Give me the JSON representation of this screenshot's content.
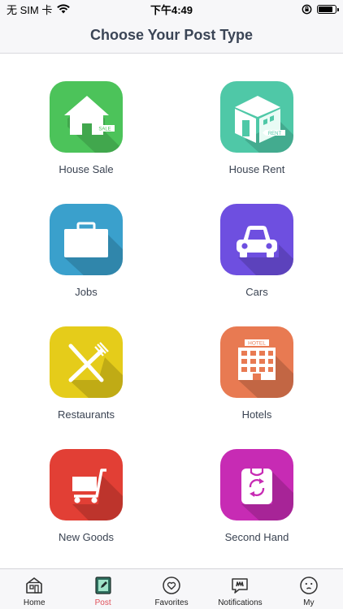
{
  "status_bar": {
    "carrier": "无 SIM 卡",
    "time": "下午4:49",
    "battery_level": 0.85
  },
  "nav": {
    "title": "Choose Your Post Type"
  },
  "post_types": [
    {
      "label": "House Sale",
      "icon": "house-sale-icon",
      "color": "#4cc35a",
      "badge": "SALE"
    },
    {
      "label": "House Rent",
      "icon": "house-rent-icon",
      "color": "#4fc8a7",
      "badge": "RENT"
    },
    {
      "label": "Jobs",
      "icon": "briefcase-icon",
      "color": "#3aa0cc"
    },
    {
      "label": "Cars",
      "icon": "car-icon",
      "color": "#6e4fe0"
    },
    {
      "label": "Restaurants",
      "icon": "fork-knife-icon",
      "color": "#e5cc1a"
    },
    {
      "label": "Hotels",
      "icon": "hotel-icon",
      "color": "#e87a52",
      "badge": "HOTEL"
    },
    {
      "label": "New Goods",
      "icon": "shopping-cart-icon",
      "color": "#e23f35"
    },
    {
      "label": "Second Hand",
      "icon": "recycle-bag-icon",
      "color": "#c72bb4"
    }
  ],
  "tab_bar": {
    "active": "Post",
    "active_color": "#e0505a",
    "tabs": [
      {
        "label": "Home",
        "icon": "home-icon"
      },
      {
        "label": "Post",
        "icon": "post-icon"
      },
      {
        "label": "Favorites",
        "icon": "heart-icon"
      },
      {
        "label": "Notifications",
        "icon": "notification-icon"
      },
      {
        "label": "My",
        "icon": "profile-face-icon"
      }
    ]
  }
}
